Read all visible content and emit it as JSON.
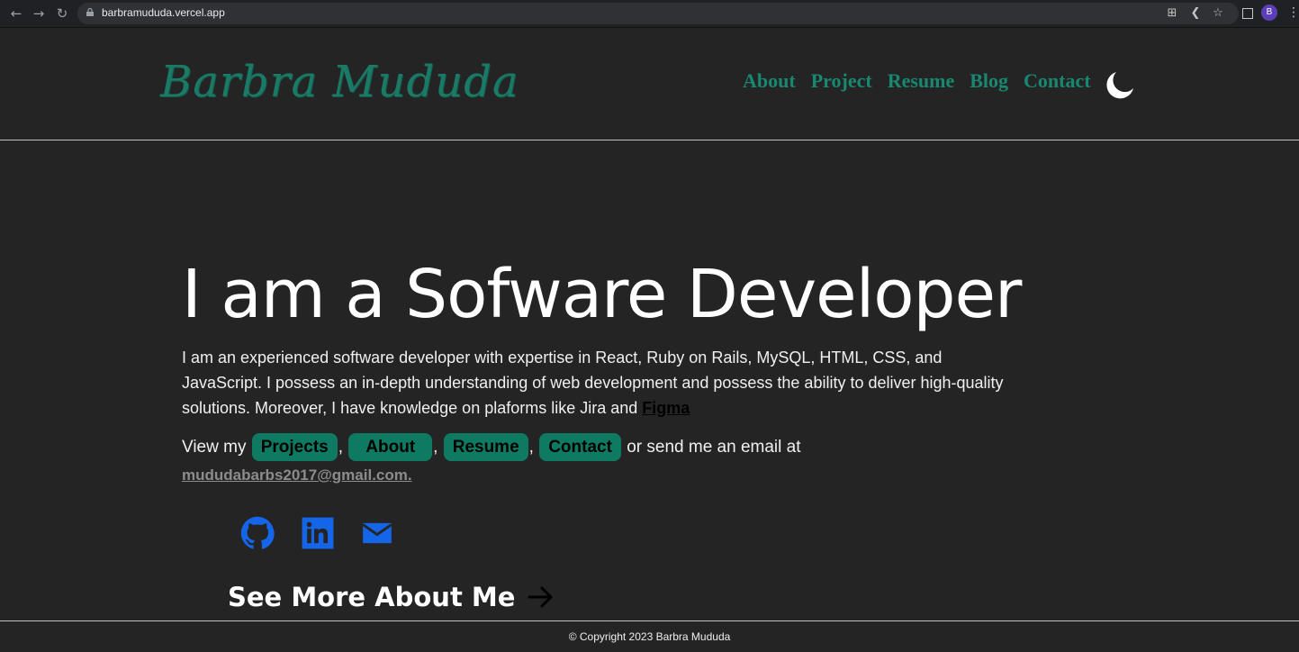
{
  "browser": {
    "url": "barbramududa.vercel.app",
    "profile_initial": "B",
    "icons": [
      "back-arrow-icon",
      "forward-arrow-icon",
      "reload-icon",
      "lock-icon",
      "install-icon",
      "share-icon",
      "star-icon",
      "side-panel-icon",
      "more-icon"
    ]
  },
  "header": {
    "logo": "Barbra Mududa",
    "nav": [
      "About",
      "Project",
      "Resume",
      "Blog",
      "Contact"
    ],
    "theme_icon": "moon-icon"
  },
  "hero": {
    "title": "I am a Sofware Developer",
    "intro": "I am an experienced software developer with expertise in React, Ruby on Rails, MySQL, HTML, CSS, and JavaScript. I possess an in-depth understanding of web development and possess the ability to deliver high-quality solutions. Moreover, I have knowledge on plaforms like Jira and ",
    "figma_link": "Figma",
    "view_my": "View my",
    "buttons": [
      "Projects",
      "About",
      "Resume",
      "Contact"
    ],
    "email_prefix": " or send me an email at",
    "email": "mududabarbs2017@gmail.com."
  },
  "social": [
    "github-icon",
    "linkedin-icon",
    "mail-icon"
  ],
  "see_more": "See More About Me",
  "footer": "© Copyright 2023 Barbra Mududa",
  "colors": {
    "background": "#242424",
    "accent": "#0f7a62",
    "nav_text": "#188870",
    "social_icons": "#1565e8",
    "text": "#ffffff"
  }
}
